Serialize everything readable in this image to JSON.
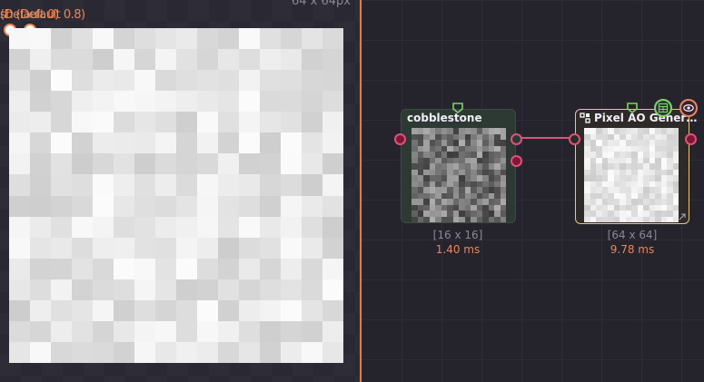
{
  "preview": {
    "size_label": "64 x 64px",
    "overlay_line1": "sh (Default 0.8)",
    "overlay_line2": "(Default 0)"
  },
  "nodes": [
    {
      "title": "cobblestone",
      "size": "[16 x 16]",
      "time": "1.40 ms"
    },
    {
      "title": "Pixel AO Gener…",
      "size": "[64 x 64]",
      "time": "9.78 ms"
    }
  ],
  "colors": {
    "accent": "#e8885c",
    "wire": "#e0507a",
    "node1_border": "#3d4a45",
    "node2_border": "#e8c78a",
    "pin": "#7fd36a"
  }
}
